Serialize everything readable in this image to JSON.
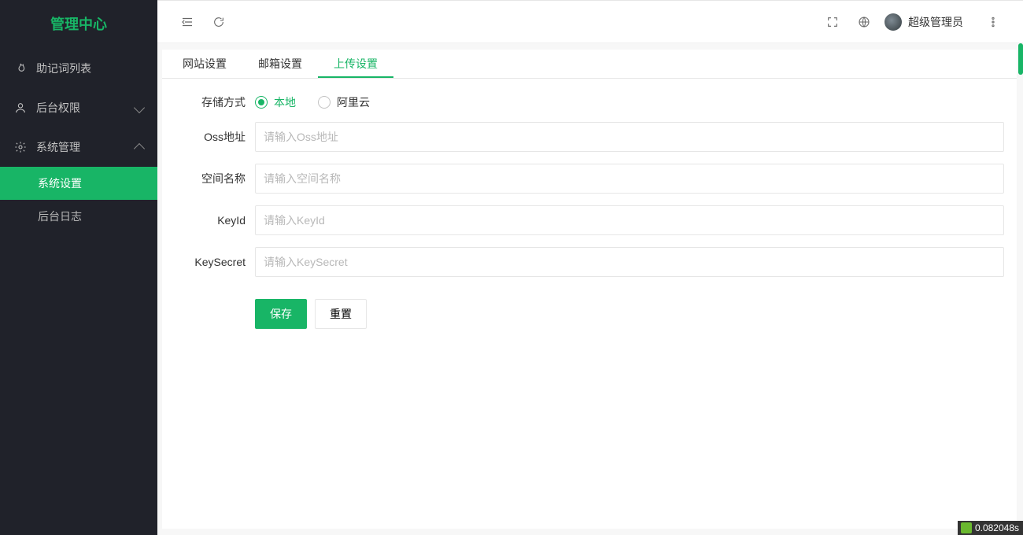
{
  "app": {
    "title": "管理中心"
  },
  "sidebar": {
    "items": [
      {
        "label": "助记词列表",
        "icon": "flame"
      },
      {
        "label": "后台权限",
        "icon": "user",
        "expandable": true,
        "expanded": false
      },
      {
        "label": "系统管理",
        "icon": "gear",
        "expandable": true,
        "expanded": true,
        "children": [
          {
            "label": "系统设置",
            "active": true
          },
          {
            "label": "后台日志",
            "active": false
          }
        ]
      }
    ]
  },
  "header": {
    "username": "超级管理员"
  },
  "tabs": [
    {
      "label": "网站设置",
      "active": false
    },
    {
      "label": "邮箱设置",
      "active": false
    },
    {
      "label": "上传设置",
      "active": true
    }
  ],
  "form": {
    "storage_label": "存储方式",
    "storage_options": [
      {
        "label": "本地",
        "value": "local",
        "selected": true
      },
      {
        "label": "阿里云",
        "value": "aliyun",
        "selected": false
      }
    ],
    "fields": {
      "oss": {
        "label": "Oss地址",
        "placeholder": "请输入Oss地址",
        "value": ""
      },
      "bucket": {
        "label": "空间名称",
        "placeholder": "请输入空间名称",
        "value": ""
      },
      "keyid": {
        "label": "KeyId",
        "placeholder": "请输入KeyId",
        "value": ""
      },
      "keysecret": {
        "label": "KeySecret",
        "placeholder": "请输入KeySecret",
        "value": ""
      }
    },
    "buttons": {
      "save": "保存",
      "reset": "重置"
    }
  },
  "badge": {
    "time": "0.082048s"
  }
}
